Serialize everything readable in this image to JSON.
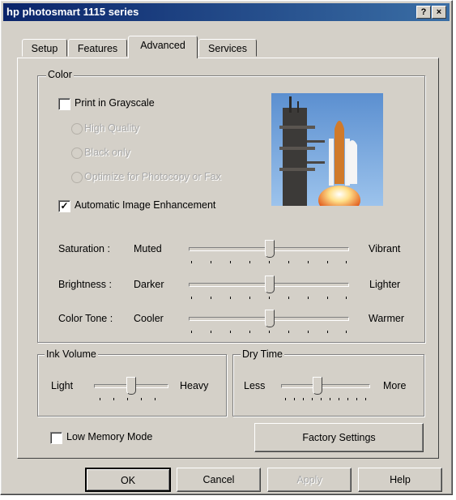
{
  "window": {
    "title": "hp photosmart 1115 series",
    "help_glyph": "?",
    "close_glyph": "×"
  },
  "tabs": [
    {
      "label": "Setup"
    },
    {
      "label": "Features"
    },
    {
      "label": "Advanced",
      "active": true
    },
    {
      "label": "Services"
    }
  ],
  "color_group": {
    "legend": "Color",
    "print_grayscale": {
      "label": "Print in Grayscale",
      "checked": false
    },
    "radios": [
      {
        "label": "High Quality",
        "enabled": false
      },
      {
        "label": "Black only",
        "enabled": false
      },
      {
        "label": "Optimize for Photocopy or Fax",
        "enabled": false
      }
    ],
    "auto_enhancement": {
      "label": "Automatic Image Enhancement",
      "checked": true
    },
    "sliders": [
      {
        "name": "Saturation :",
        "min_label": "Muted",
        "max_label": "Vibrant",
        "level": 0.5
      },
      {
        "name": "Brightness :",
        "min_label": "Darker",
        "max_label": "Lighter",
        "level": 0.5
      },
      {
        "name": "Color Tone :",
        "min_label": "Cooler",
        "max_label": "Warmer",
        "level": 0.5
      }
    ]
  },
  "ink_volume": {
    "legend": "Ink Volume",
    "min_label": "Light",
    "max_label": "Heavy",
    "level": 0.5
  },
  "dry_time": {
    "legend": "Dry Time",
    "min_label": "Less",
    "max_label": "More",
    "level": 0.4
  },
  "low_memory": {
    "label": "Low Memory Mode",
    "checked": false
  },
  "factory_settings": {
    "label": "Factory Settings"
  },
  "footer": {
    "ok": "OK",
    "cancel": "Cancel",
    "apply": "Apply",
    "help": "Help"
  },
  "colors": {
    "titlebar_start": "#0a246a",
    "titlebar_end": "#3a6ea5",
    "face": "#d4d0c8"
  }
}
